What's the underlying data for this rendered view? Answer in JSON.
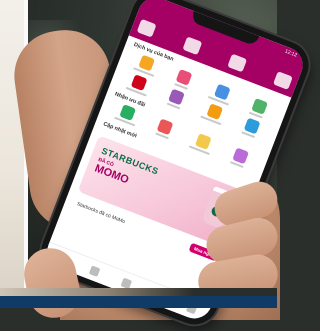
{
  "photo": {
    "description_colors": {
      "brand": "#a50064",
      "starbucks_green": "#0a6b47"
    }
  },
  "app": {
    "status_time": "12:12",
    "sections": [
      {
        "title": "Dịch vụ của bạn",
        "link": ""
      },
      {
        "title": "Nhận ưu đãi",
        "link": ""
      },
      {
        "title": "Cập nhật mới",
        "link": ""
      }
    ],
    "promo": {
      "brand": "STARBUCKS",
      "sub": "ĐÃ CÓ",
      "main": "MOMO"
    },
    "card": {
      "text": "Starbucks đã có MoMo",
      "cta": "Mua ngay"
    },
    "top_icons": [
      "wallet-icon",
      "transfer-icon",
      "scan-icon",
      "card-icon"
    ],
    "nav_icons": [
      "home-icon",
      "promo-icon",
      "scan-icon",
      "history-icon",
      "user-icon"
    ]
  }
}
